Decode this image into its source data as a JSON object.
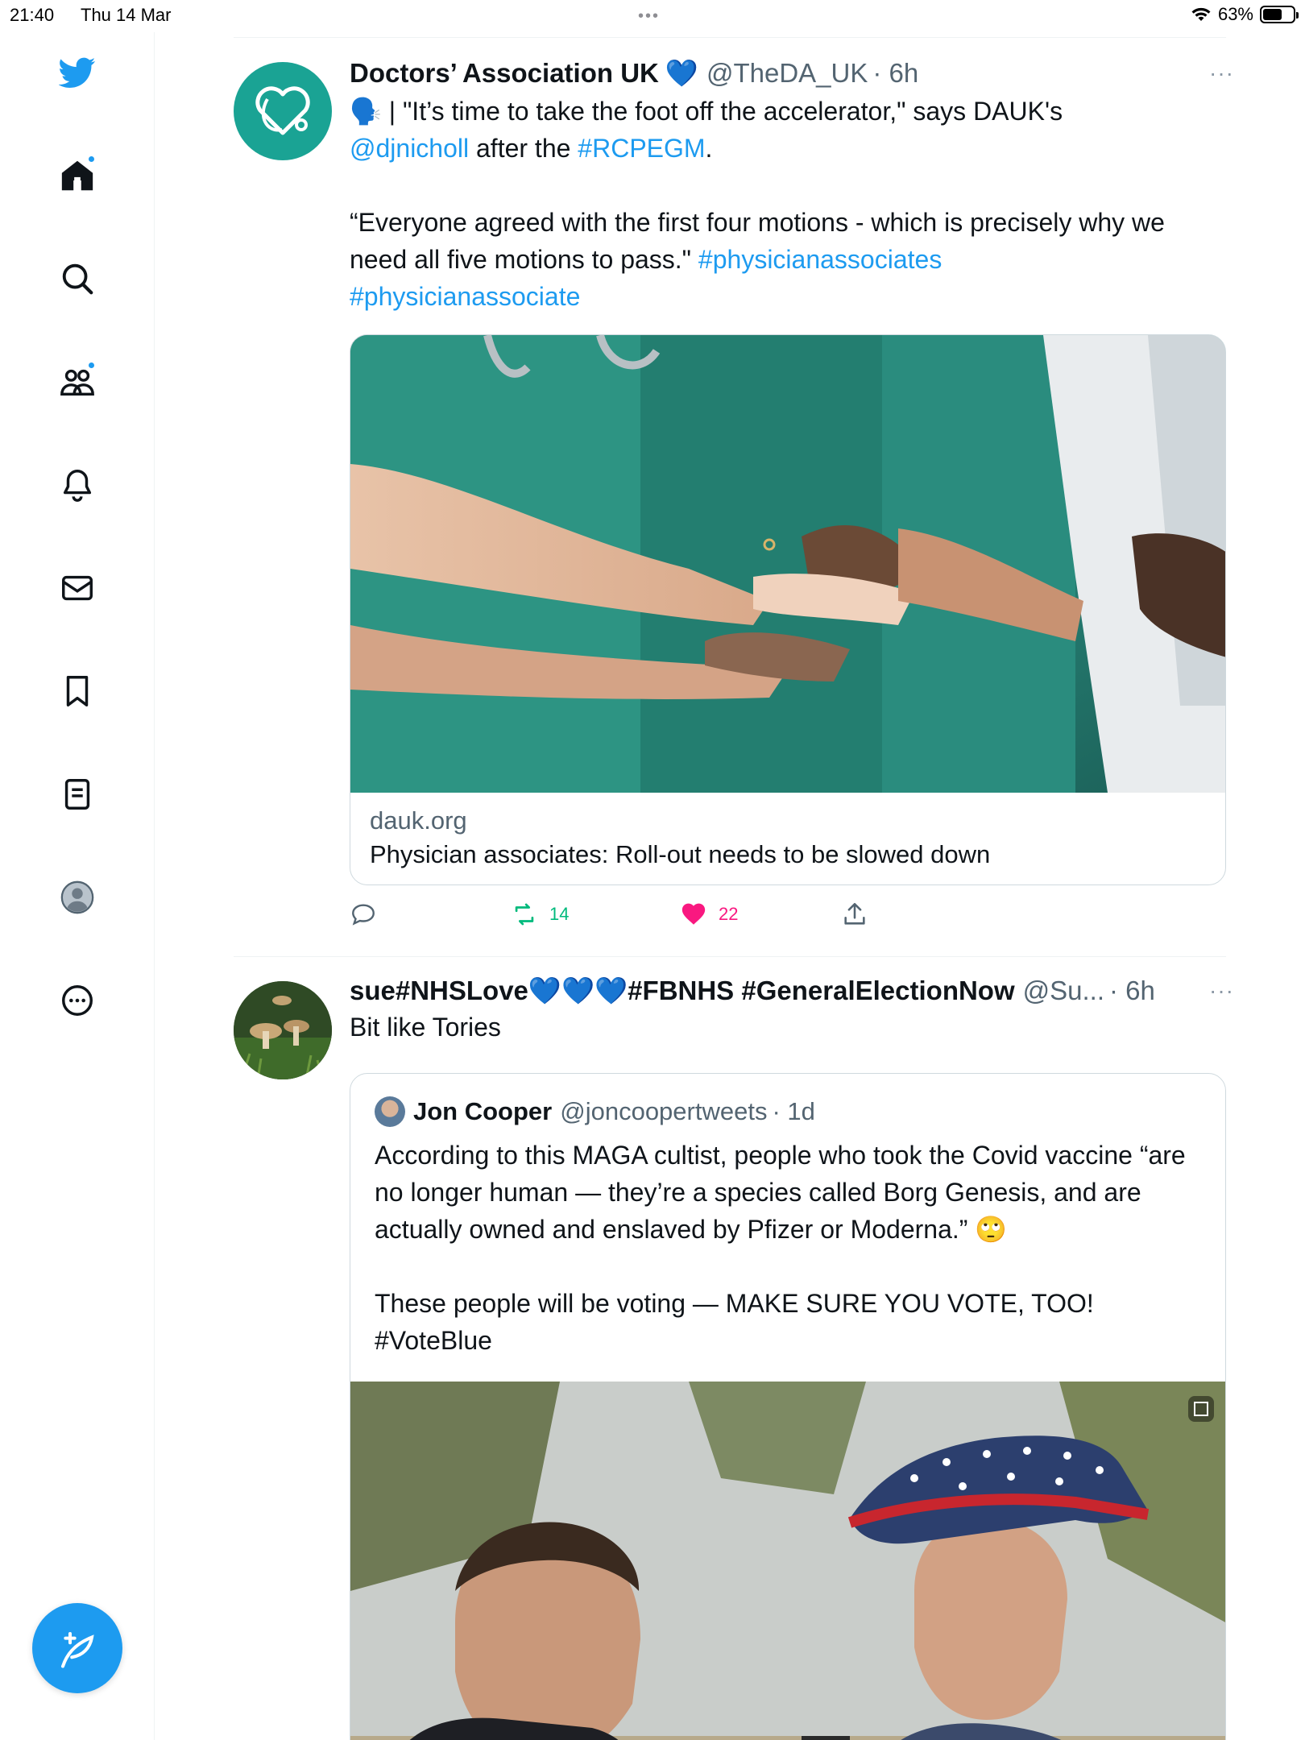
{
  "status_bar": {
    "time": "21:40",
    "date": "Thu 14 Mar",
    "dots": "•••",
    "battery": "63%",
    "battery_level": 0.63
  },
  "sidebar": {
    "items": [
      {
        "icon": "twitter-logo-icon"
      },
      {
        "icon": "home-icon",
        "has_dot": true
      },
      {
        "icon": "search-icon"
      },
      {
        "icon": "communities-icon",
        "has_dot": true
      },
      {
        "icon": "notifications-bell-icon"
      },
      {
        "icon": "messages-envelope-icon"
      },
      {
        "icon": "bookmark-icon"
      },
      {
        "icon": "lists-icon"
      },
      {
        "icon": "profile-avatar-icon"
      },
      {
        "icon": "more-circle-icon"
      }
    ],
    "compose_icon": "compose-feather-icon"
  },
  "colors": {
    "accent": "#1d9bf0",
    "like": "#f91880",
    "retweet": "#00ba7c",
    "secondary_text": "#536471"
  },
  "tweets": [
    {
      "name": "Doctors’ Association UK",
      "verified_heart": "💙",
      "handle": "@TheDA_UK",
      "time": "· 6h",
      "more": "···",
      "text_emoji": "🗣️",
      "text_line1_rest": " | \"It’s time to take the foot off the accelerator,\" says DAUK's",
      "mention": "@djnicholl",
      "text_after_mention": " after the ",
      "hashtag1": "#RCPEGM",
      "text_period": ".",
      "text_para2": "“Everyone agreed with the first four motions - which is precisely why we need all five motions to pass.\"",
      "hashtag2": "#physicianassociates",
      "hashtag3": "#physicianassociate",
      "card": {
        "domain": "dauk.org",
        "title": "Physician associates: Roll-out needs to be slowed down"
      },
      "actions": {
        "reply_count": "",
        "retweet_count": "14",
        "like_count": "22"
      }
    },
    {
      "name": "sue#NHSLove💙💙💙#FBNHS #GeneralElectionNow",
      "handle": "@Su...",
      "time": "· 6h",
      "more": "···",
      "text": "Bit like Tories",
      "quote": {
        "name": "Jon Cooper",
        "handle": "@joncoopertweets",
        "time": "· 1d",
        "text_para1": "According to this MAGA cultist, people who took the Covid vaccine “are no longer human — they’re a species called Borg Genesis, and are actually owned and enslaved by Pfizer or Moderna.” 🙄",
        "text_para2": "These people will be voting — MAKE SURE YOU VOTE, TOO!",
        "hashtag": "#VoteBlue"
      }
    }
  ]
}
